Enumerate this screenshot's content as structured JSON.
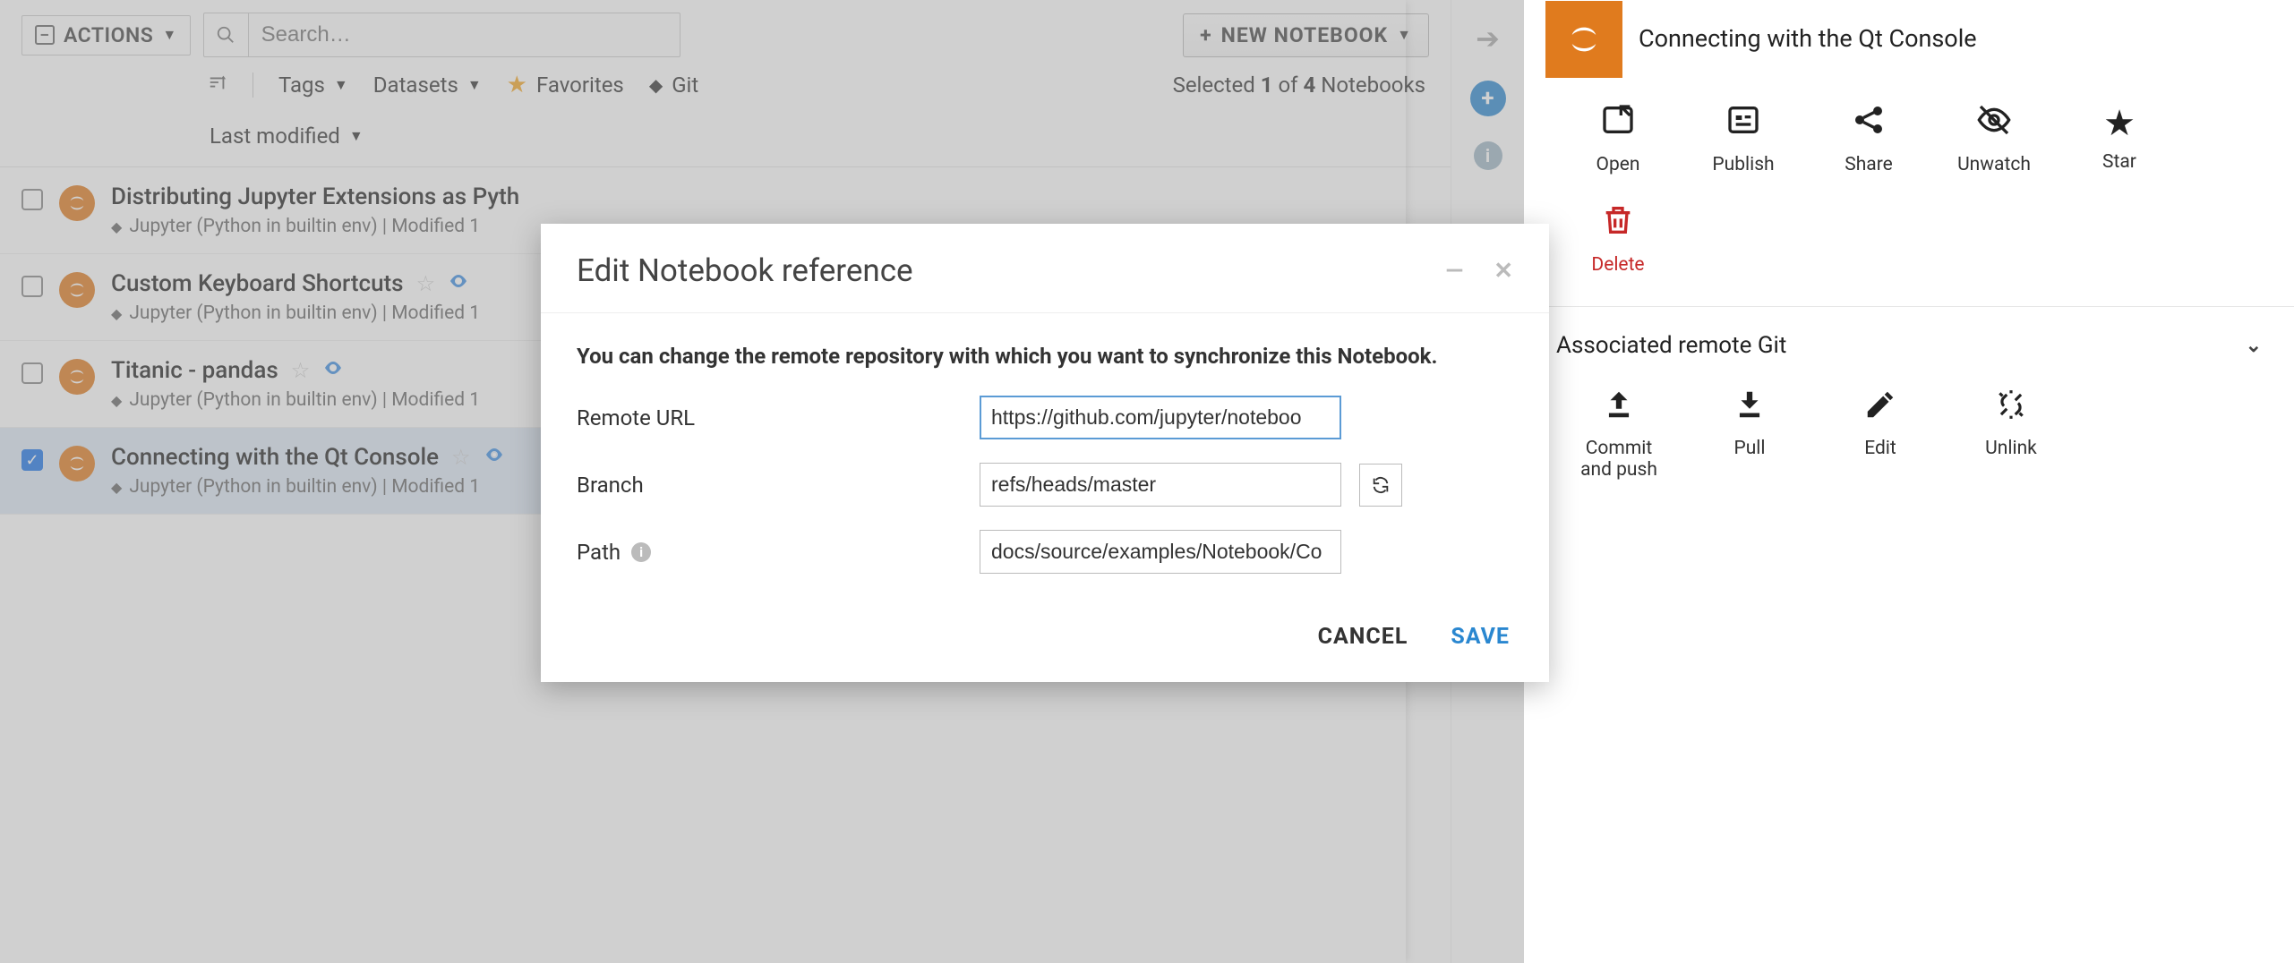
{
  "toolbar": {
    "actions_label": "ACTIONS",
    "search_placeholder": "Search…",
    "new_notebook_label": "NEW NOTEBOOK"
  },
  "filters": {
    "sort_icon_name": "sort-icon",
    "tags_label": "Tags",
    "datasets_label": "Datasets",
    "favorites_label": "Favorites",
    "git_label": "Git",
    "last_modified_label": "Last modified"
  },
  "selection": {
    "prefix": "Selected",
    "count": "1",
    "of": "of",
    "total": "4",
    "suffix": "Notebooks"
  },
  "notebooks": [
    {
      "title": "Distributing Jupyter Extensions as Pyth",
      "meta": "Jupyter (Python in builtin env) | Modified 1",
      "checked": false,
      "show_star_outline": false,
      "show_eye": false
    },
    {
      "title": "Custom Keyboard Shortcuts",
      "meta": "Jupyter (Python in builtin env) | Modified 1",
      "checked": false,
      "show_star_outline": true,
      "show_eye": true
    },
    {
      "title": "Titanic - pandas",
      "meta": "Jupyter (Python in builtin env) | Modified 1",
      "checked": false,
      "show_star_outline": true,
      "show_eye": true
    },
    {
      "title": "Connecting with the Qt Console",
      "meta": "Jupyter (Python in builtin env) | Modified 1",
      "checked": true,
      "show_star_outline": true,
      "show_eye": true
    }
  ],
  "detail": {
    "title": "Connecting with the Qt Console",
    "actions": {
      "open": "Open",
      "publish": "Publish",
      "share": "Share",
      "unwatch": "Unwatch",
      "star": "Star",
      "delete": "Delete"
    },
    "git_section_title": "Associated remote Git",
    "git_actions": {
      "commit_push": "Commit and push",
      "pull": "Pull",
      "edit": "Edit",
      "unlink": "Unlink"
    }
  },
  "modal": {
    "title": "Edit Notebook reference",
    "description": "You can change the remote repository with which you want to synchronize this Notebook.",
    "remote_url_label": "Remote URL",
    "remote_url_value": "https://github.com/jupyter/noteboo",
    "branch_label": "Branch",
    "branch_value": "refs/heads/master",
    "path_label": "Path",
    "path_value": "docs/source/examples/Notebook/Co",
    "cancel_label": "CANCEL",
    "save_label": "SAVE"
  }
}
